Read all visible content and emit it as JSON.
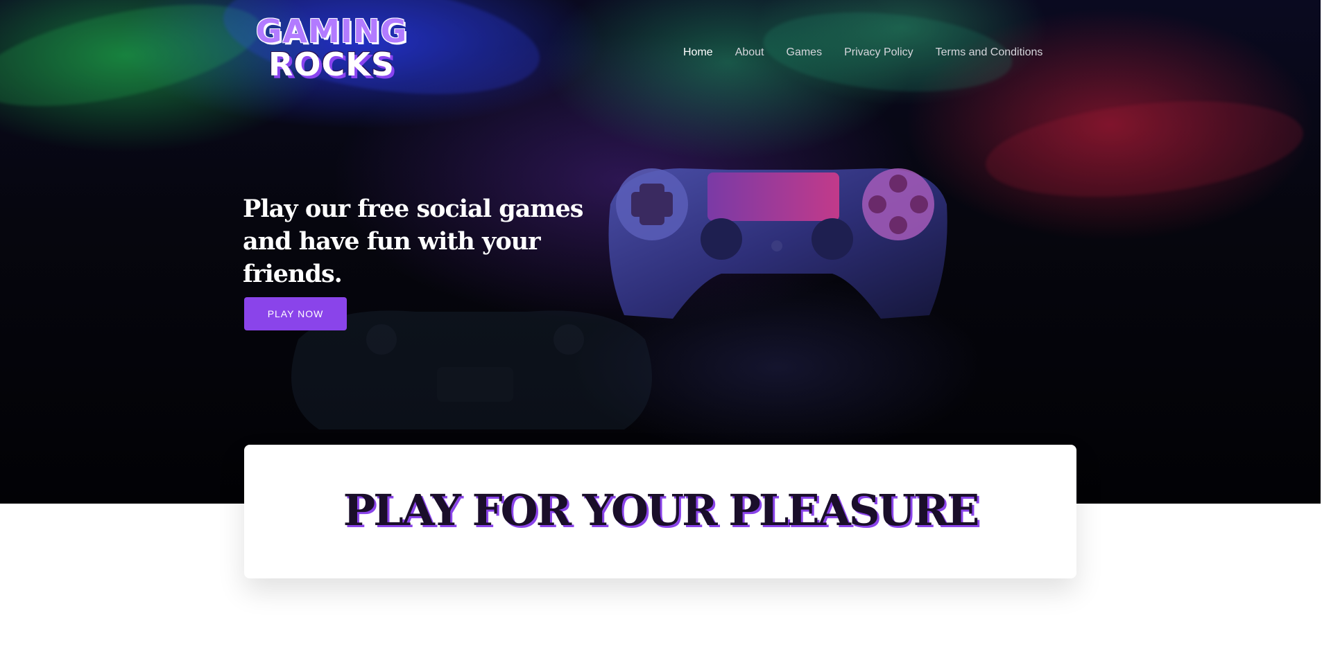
{
  "brand": {
    "logo_line1": "GAMING",
    "logo_line2": "ROCKS"
  },
  "nav": {
    "items": [
      {
        "label": "Home"
      },
      {
        "label": "About"
      },
      {
        "label": "Games"
      },
      {
        "label": "Privacy Policy"
      },
      {
        "label": "Terms and Conditions"
      }
    ]
  },
  "hero": {
    "title": "Play our free social games and have fun with your friends.",
    "cta_label": "PLAY NOW",
    "image": "gamepad-controller"
  },
  "section": {
    "title": "PLAY FOR YOUR PLEASURE"
  },
  "colors": {
    "accent": "#8a44ea",
    "logo_purple": "#b27bff",
    "heading_dark": "#1a0e2a",
    "hero_bg": "#05050c"
  }
}
